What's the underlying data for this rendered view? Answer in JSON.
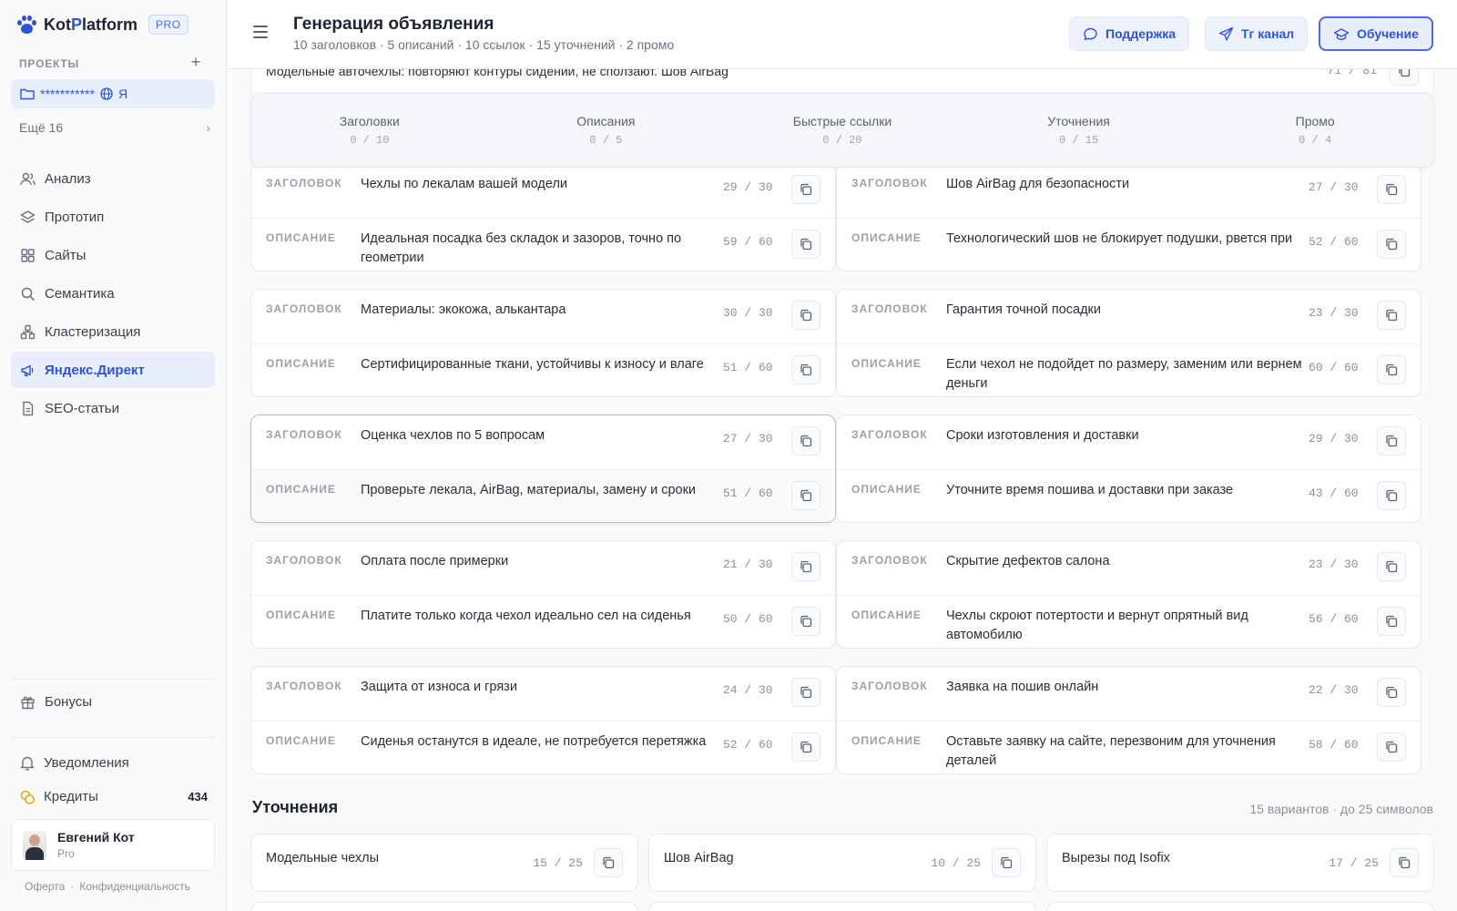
{
  "sidebar": {
    "logo": {
      "part1": "Kot",
      "part2": "P",
      "part3": "latform",
      "badge": "PRO"
    },
    "projects_label": "ПРОЕКТЫ",
    "project": {
      "name": "***********",
      "suffix": "Я"
    },
    "more_projects": "Ещё 16",
    "nav": [
      {
        "label": "Анализ",
        "icon": "users-icon"
      },
      {
        "label": "Прототип",
        "icon": "layers-icon"
      },
      {
        "label": "Сайты",
        "icon": "grid-icon"
      },
      {
        "label": "Семантика",
        "icon": "search-icon"
      },
      {
        "label": "Кластеризация",
        "icon": "cluster-icon"
      },
      {
        "label": "Яндекс.Директ",
        "icon": "megaphone-icon",
        "active": true
      },
      {
        "label": "SEO-статьи",
        "icon": "document-icon"
      }
    ],
    "bonuses": "Бонусы",
    "notifications": "Уведомления",
    "credits": {
      "label": "Кредиты",
      "count": "434"
    },
    "user": {
      "name": "Евгений Кот",
      "plan": "Pro"
    },
    "legal": {
      "offer": "Оферта",
      "sep": "·",
      "privacy": "Конфиденциальность"
    }
  },
  "header": {
    "title": "Генерация объявления",
    "subtitle": "10 заголовков · 5 описаний · 10 ссылок · 15 уточнений · 2 промо",
    "buttons": {
      "support": "Поддержка",
      "tg": "Тг канал",
      "learn": "Обучение"
    }
  },
  "top_line": {
    "text": "Модельные авточехлы: повторяют контуры сидений, не сползают. Шов AirBag",
    "count": "71 / 81"
  },
  "tabs": [
    {
      "label": "Заголовки",
      "count": "0 / 10"
    },
    {
      "label": "Описания",
      "count": "0 / 5"
    },
    {
      "label": "Быстрые ссылки",
      "count": "0 / 20"
    },
    {
      "label": "Уточнения",
      "count": "0 / 15"
    },
    {
      "label": "Промо",
      "count": "0 / 4"
    }
  ],
  "ads": {
    "heading_kind": "ЗАГОЛОВОК",
    "desc_kind": "ОПИСАНИЕ",
    "cards": [
      {
        "h": "Чехлы по лекалам вашей модели",
        "hc": "29 / 30",
        "d": "Идеальная посадка без складок и зазоров, точно по геометрии",
        "dc": "59 / 60"
      },
      {
        "h": "Шов AirBag для безопасности",
        "hc": "27 / 30",
        "d": "Технологический шов не блокирует подушки, рвется при",
        "dc": "52 / 60"
      },
      {
        "h": "Материалы: экокожа, алькантара",
        "hc": "30 / 30",
        "d": "Сертифицированные ткани, устойчивы к износу и влаге",
        "dc": "51 / 60"
      },
      {
        "h": "Гарантия точной посадки",
        "hc": "23 / 30",
        "d": "Если чехол не подойдет по размеру, заменим или вернем деньги",
        "dc": "60 / 60"
      },
      {
        "h": "Оценка чехлов по 5 вопросам",
        "hc": "27 / 30",
        "d": "Проверьте лекала, AirBag, материалы, замену и сроки",
        "dc": "51 / 60"
      },
      {
        "h": "Сроки изготовления и доставки",
        "hc": "29 / 30",
        "d": "Уточните время пошива и доставки при заказе",
        "dc": "43 / 60"
      },
      {
        "h": "Оплата после примерки",
        "hc": "21 / 30",
        "d": "Платите только когда чехол идеально сел на сиденья",
        "dc": "50 / 60"
      },
      {
        "h": "Скрытие дефектов салона",
        "hc": "23 / 30",
        "d": "Чехлы скроют потертости и вернут опрятный вид автомобилю",
        "dc": "56 / 60"
      },
      {
        "h": "Защита от износа и грязи",
        "hc": "24 / 30",
        "d": "Сиденья останутся в идеале, не потребуется перетяжка",
        "dc": "52 / 60"
      },
      {
        "h": "Заявка на пошив онлайн",
        "hc": "22 / 30",
        "d": "Оставьте заявку на сайте, перезвоним для уточнения деталей",
        "dc": "58 / 60"
      }
    ]
  },
  "refinements": {
    "title": "Уточнения",
    "meta": "15 вариантов · до 25 символов",
    "items": [
      {
        "text": "Модельные чехлы",
        "count": "15 / 25"
      },
      {
        "text": "Шов AirBag",
        "count": "10 / 25"
      },
      {
        "text": "Вырезы под Isofix",
        "count": "17 / 25"
      }
    ]
  }
}
